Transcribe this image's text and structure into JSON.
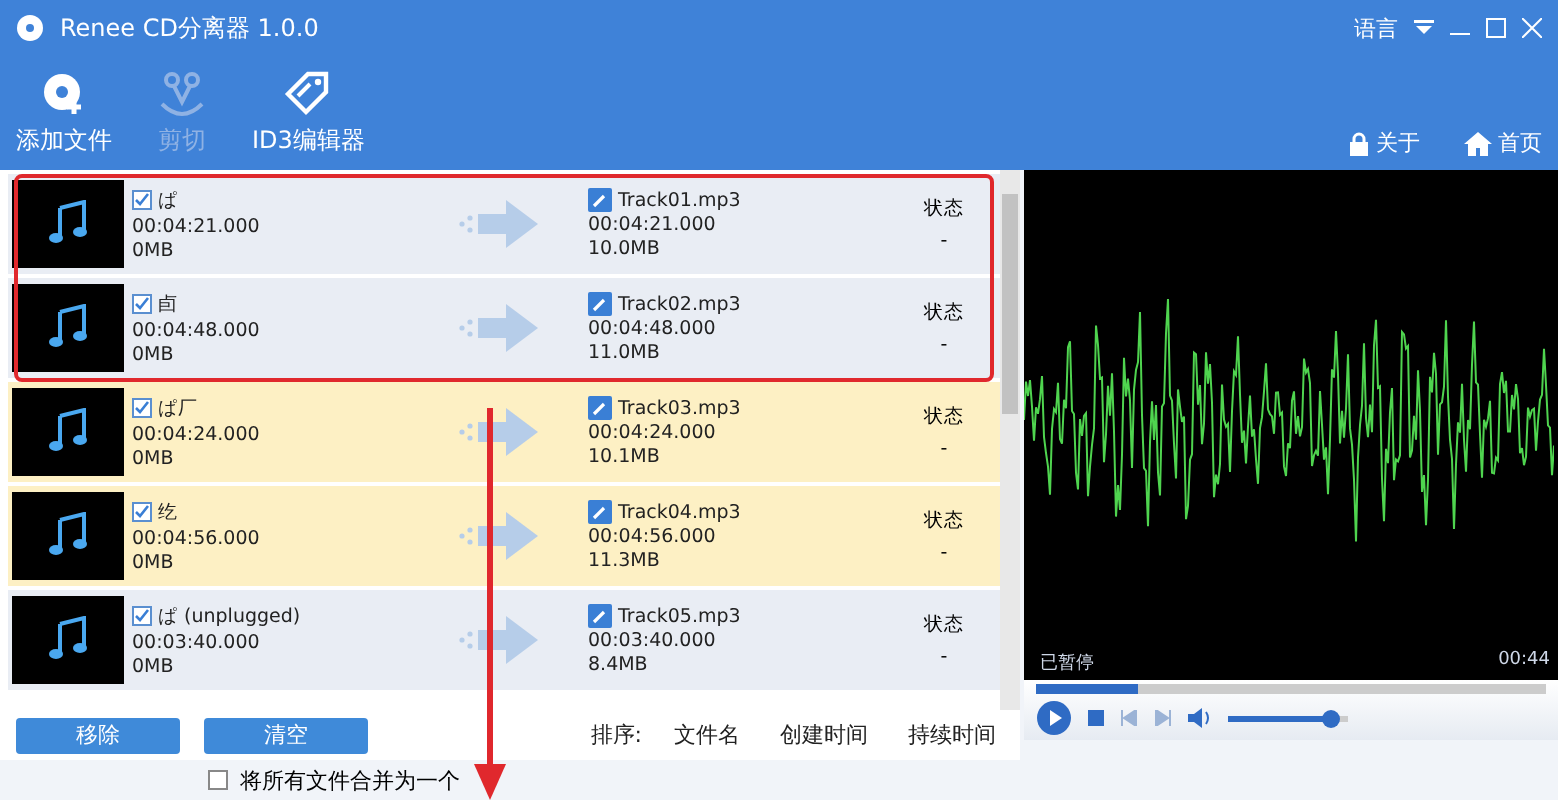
{
  "window": {
    "title": "Renee CD分离器 1.0.0",
    "language": "语言"
  },
  "toolbar": [
    {
      "label": "添加文件",
      "disabled": false,
      "kind": "add"
    },
    {
      "label": "剪切",
      "disabled": true,
      "kind": "cut"
    },
    {
      "label": "ID3编辑器",
      "disabled": false,
      "kind": "tag"
    }
  ],
  "links": [
    {
      "label": "关于",
      "kind": "lock"
    },
    {
      "label": "首页",
      "kind": "home"
    }
  ],
  "tracks": [
    {
      "name": "ぱ",
      "duration": "00:04:21.000",
      "size": "0MB",
      "checked": true,
      "selected": false,
      "output": "Track01.mp3",
      "out_duration": "00:04:21.000",
      "out_size": "10.0MB",
      "status": "状态",
      "status_value": "-"
    },
    {
      "name": "卣",
      "duration": "00:04:48.000",
      "size": "0MB",
      "checked": true,
      "selected": false,
      "output": "Track02.mp3",
      "out_duration": "00:04:48.000",
      "out_size": "11.0MB",
      "status": "状态",
      "status_value": "-"
    },
    {
      "name": "ぱ厂",
      "duration": "00:04:24.000",
      "size": "0MB",
      "checked": true,
      "selected": true,
      "output": "Track03.mp3",
      "out_duration": "00:04:24.000",
      "out_size": "10.1MB",
      "status": "状态",
      "status_value": "-"
    },
    {
      "name": "纥",
      "duration": "00:04:56.000",
      "size": "0MB",
      "checked": true,
      "selected": true,
      "output": "Track04.mp3",
      "out_duration": "00:04:56.000",
      "out_size": "11.3MB",
      "status": "状态",
      "status_value": "-"
    },
    {
      "name": "ぱ  (unplugged)",
      "duration": "00:03:40.000",
      "size": "0MB",
      "checked": true,
      "selected": false,
      "output": "Track05.mp3",
      "out_duration": "00:03:40.000",
      "out_size": "8.4MB",
      "status": "状态",
      "status_value": "-"
    }
  ],
  "buttons": [
    "移除",
    "清空"
  ],
  "sort": {
    "label": "排序:",
    "options": [
      "文件名",
      "创建时间",
      "持续时间"
    ]
  },
  "player": {
    "state": "已暂停",
    "time": "00:44",
    "seek": {
      "level": 0.2
    },
    "volume": {
      "level": 0.85
    }
  },
  "merge": {
    "label": "将所有文件合并为一个",
    "checked": false
  }
}
